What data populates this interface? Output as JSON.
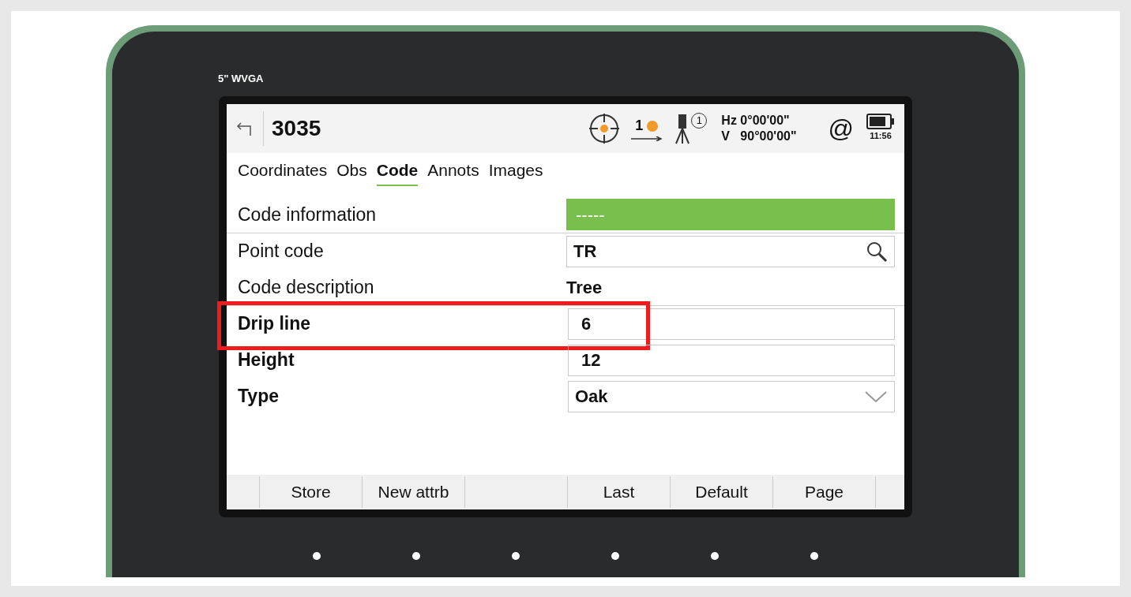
{
  "device": {
    "label": "5\" WVGA"
  },
  "header": {
    "title": "3035",
    "angles": [
      "Hz 0°00'00\"",
      "V   90°00'00\""
    ],
    "prism_count": "1",
    "station_badge": "1",
    "time": "11:56",
    "at_sign": "@"
  },
  "tabs": [
    {
      "label": "Coordinates",
      "selected": false
    },
    {
      "label": "Obs",
      "selected": false
    },
    {
      "label": "Code",
      "selected": true
    },
    {
      "label": "Annots",
      "selected": false
    },
    {
      "label": "Images",
      "selected": false
    }
  ],
  "fields": [
    {
      "kind": "info",
      "label": "Code information",
      "value": "-----",
      "bold": false,
      "highlighted": false
    },
    {
      "kind": "search",
      "label": "Point code",
      "value": "TR",
      "bold": false,
      "highlighted": false
    },
    {
      "kind": "readonly",
      "label": "Code description",
      "value": "Tree",
      "bold": false,
      "highlighted": false
    },
    {
      "kind": "input",
      "label": "Drip line",
      "value": "6",
      "bold": true,
      "highlighted": true
    },
    {
      "kind": "input",
      "label": "Height",
      "value": "12",
      "bold": true,
      "highlighted": false
    },
    {
      "kind": "dropdown",
      "label": "Type",
      "value": "Oak",
      "bold": true,
      "highlighted": false
    }
  ],
  "softkeys": [
    {
      "kind": "key",
      "label": "Store"
    },
    {
      "kind": "key",
      "label": "New attrb"
    },
    {
      "kind": "blank"
    },
    {
      "kind": "key",
      "label": "Last"
    },
    {
      "kind": "key",
      "label": "Default"
    },
    {
      "kind": "key",
      "label": "Page"
    }
  ]
}
